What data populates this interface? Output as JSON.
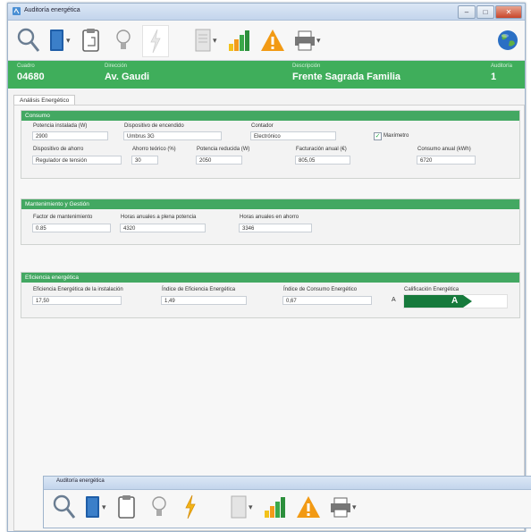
{
  "window": {
    "title": "Auditoría energética",
    "controls": [
      "–",
      "□",
      "✕"
    ]
  },
  "toolbar": {
    "icons": [
      "search-icon",
      "book-icon",
      "clipboard-icon",
      "lightbulb-icon",
      "lightning-icon",
      "document-icon",
      "chart-icon",
      "warning-icon",
      "printer-icon",
      "globe-icon"
    ],
    "dropdown_glyph": "▾"
  },
  "info": {
    "cuadro_label": "Cuadro",
    "cuadro_value": "04680",
    "direccion_label": "Dirección",
    "direccion_value": "Av. Gaudi",
    "descripcion_label": "Descripción",
    "descripcion_value": "Frente Sagrada Familia",
    "auditoria_label": "Auditoría",
    "auditoria_value": "1"
  },
  "tab": {
    "label": "Análisis Energético"
  },
  "consumo": {
    "title": "Consumo",
    "potencia_instalada_label": "Potencia instalada (W)",
    "potencia_instalada_value": "2900",
    "dispositivo_encendido_label": "Dispositivo de encendido",
    "dispositivo_encendido_value": "Umbrus 3G",
    "contador_label": "Contador",
    "contador_value": "Electrónico",
    "maximetro_label": "Maxímetro",
    "maximetro_checked": "✓",
    "dispositivo_ahorro_label": "Dispositivo de ahorro",
    "dispositivo_ahorro_value": "Regulador de tensión",
    "ahorro_teorico_label": "Ahorro teórico (%)",
    "ahorro_teorico_value": "30",
    "potencia_reducida_label": "Potencia reducida (W)",
    "potencia_reducida_value": "2050",
    "facturacion_label": "Facturación anual (€)",
    "facturacion_value": "805,05",
    "consumo_anual_label": "Consumo anual (kWh)",
    "consumo_anual_value": "6720"
  },
  "mantenimiento": {
    "title": "Mantenimiento y Gestión",
    "factor_label": "Factor de mantenimiento",
    "factor_value": "0.85",
    "horas_plena_label": "Horas anuales a plena potencia",
    "horas_plena_value": "4320",
    "horas_ahorro_label": "Horas anuales en ahorro",
    "horas_ahorro_value": "3346"
  },
  "eficiencia": {
    "title": "Eficiencia energética",
    "eficiencia_instalacion_label": "Eficiencia Energética de la instalación",
    "eficiencia_instalacion_value": "17,50",
    "indice_eficiencia_label": "Índice de Eficiencia Energética",
    "indice_eficiencia_value": "1,49",
    "indice_consumo_label": "Índice de Consumo Energético",
    "indice_consumo_value": "0,67",
    "indice_consumo_letter": "A",
    "calificacion_label": "Calificación Energética",
    "calificacion_value": "A",
    "grade_color": "#167a3c"
  },
  "second_window": {
    "title": "Auditoría energética"
  }
}
